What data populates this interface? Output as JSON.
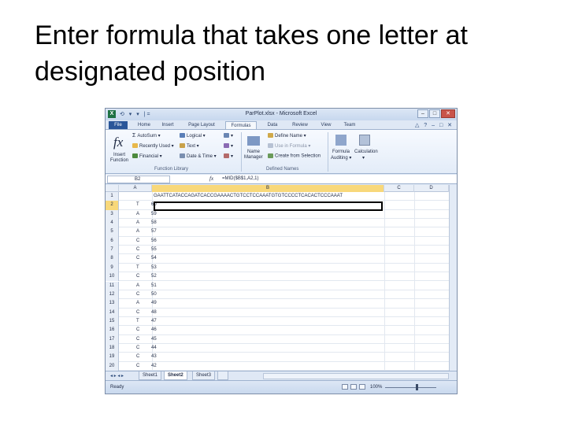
{
  "slide": {
    "title": "Enter formula that takes one letter at designated position"
  },
  "window": {
    "title": "ParPlot.xlsx - Microsoft Excel",
    "app_icon": "X",
    "qat": "⟲ ▾ ▾ |=",
    "buttons": {
      "minimize": "–",
      "maximize": "□",
      "close": "✕"
    }
  },
  "tabs": [
    "File",
    "Home",
    "Insert",
    "Page Layout",
    "Formulas",
    "Data",
    "Review",
    "View",
    "Team"
  ],
  "tabs_right": "△ ? – □ ✕",
  "ribbon": {
    "insert_function": [
      "Insert",
      "Function"
    ],
    "library": {
      "autosum": "AutoSum ▾",
      "recently_used": "Recently Used ▾",
      "financial": "Financial ▾",
      "logical": "Logical ▾",
      "text": "Text ▾",
      "date_time": "Date & Time ▾",
      "label": "Function Library"
    },
    "names": {
      "name_manager": [
        "Name",
        "Manager"
      ],
      "define_name": "Define Name ▾",
      "use_in_formula": "Use in Formula ▾",
      "create_from_selection": "Create from Selection",
      "label": "Defined Names"
    },
    "formula_auditing": [
      "Formula",
      "Auditing ▾"
    ],
    "calculation": [
      "Calculation",
      "▾"
    ]
  },
  "formula_bar": {
    "name_box": "B2",
    "fx": "fx",
    "formula": "=MID($B$1,A2,1)"
  },
  "columns": [
    "A",
    "B",
    "C",
    "D"
  ],
  "rows": [
    {
      "n": "1",
      "a": "",
      "l": "",
      "b": "GAATTCATACCAGATCACCGAAAACTGTCCTCCAAATGTGTCCCCTCACACTCCCAAAT"
    },
    {
      "n": "2",
      "a": "60",
      "l": "T",
      "b": ""
    },
    {
      "n": "3",
      "a": "59",
      "l": "A",
      "b": ""
    },
    {
      "n": "4",
      "a": "58",
      "l": "A",
      "b": ""
    },
    {
      "n": "5",
      "a": "57",
      "l": "A",
      "b": ""
    },
    {
      "n": "6",
      "a": "56",
      "l": "C",
      "b": ""
    },
    {
      "n": "7",
      "a": "55",
      "l": "C",
      "b": ""
    },
    {
      "n": "8",
      "a": "54",
      "l": "C",
      "b": ""
    },
    {
      "n": "9",
      "a": "53",
      "l": "T",
      "b": ""
    },
    {
      "n": "10",
      "a": "52",
      "l": "C",
      "b": ""
    },
    {
      "n": "11",
      "a": "51",
      "l": "A",
      "b": ""
    },
    {
      "n": "12",
      "a": "50",
      "l": "C",
      "b": ""
    },
    {
      "n": "13",
      "a": "49",
      "l": "A",
      "b": ""
    },
    {
      "n": "14",
      "a": "48",
      "l": "C",
      "b": ""
    },
    {
      "n": "15",
      "a": "47",
      "l": "T",
      "b": ""
    },
    {
      "n": "16",
      "a": "46",
      "l": "C",
      "b": ""
    },
    {
      "n": "17",
      "a": "45",
      "l": "C",
      "b": ""
    },
    {
      "n": "18",
      "a": "44",
      "l": "C",
      "b": ""
    },
    {
      "n": "19",
      "a": "43",
      "l": "C",
      "b": ""
    },
    {
      "n": "20",
      "a": "42",
      "l": "C",
      "b": ""
    }
  ],
  "sheets": [
    "Sheet1",
    "Sheet2",
    "Sheet3"
  ],
  "nav_buttons": "◂ ▸ ◂ ▸",
  "status": {
    "text": "Ready",
    "zoom": "100%",
    "zoom_minus": "–",
    "zoom_plus": "+"
  },
  "colors": {
    "file_tab": "#2a5699",
    "selected_header": "#f8d87a",
    "excel_green": "#1f7244"
  }
}
